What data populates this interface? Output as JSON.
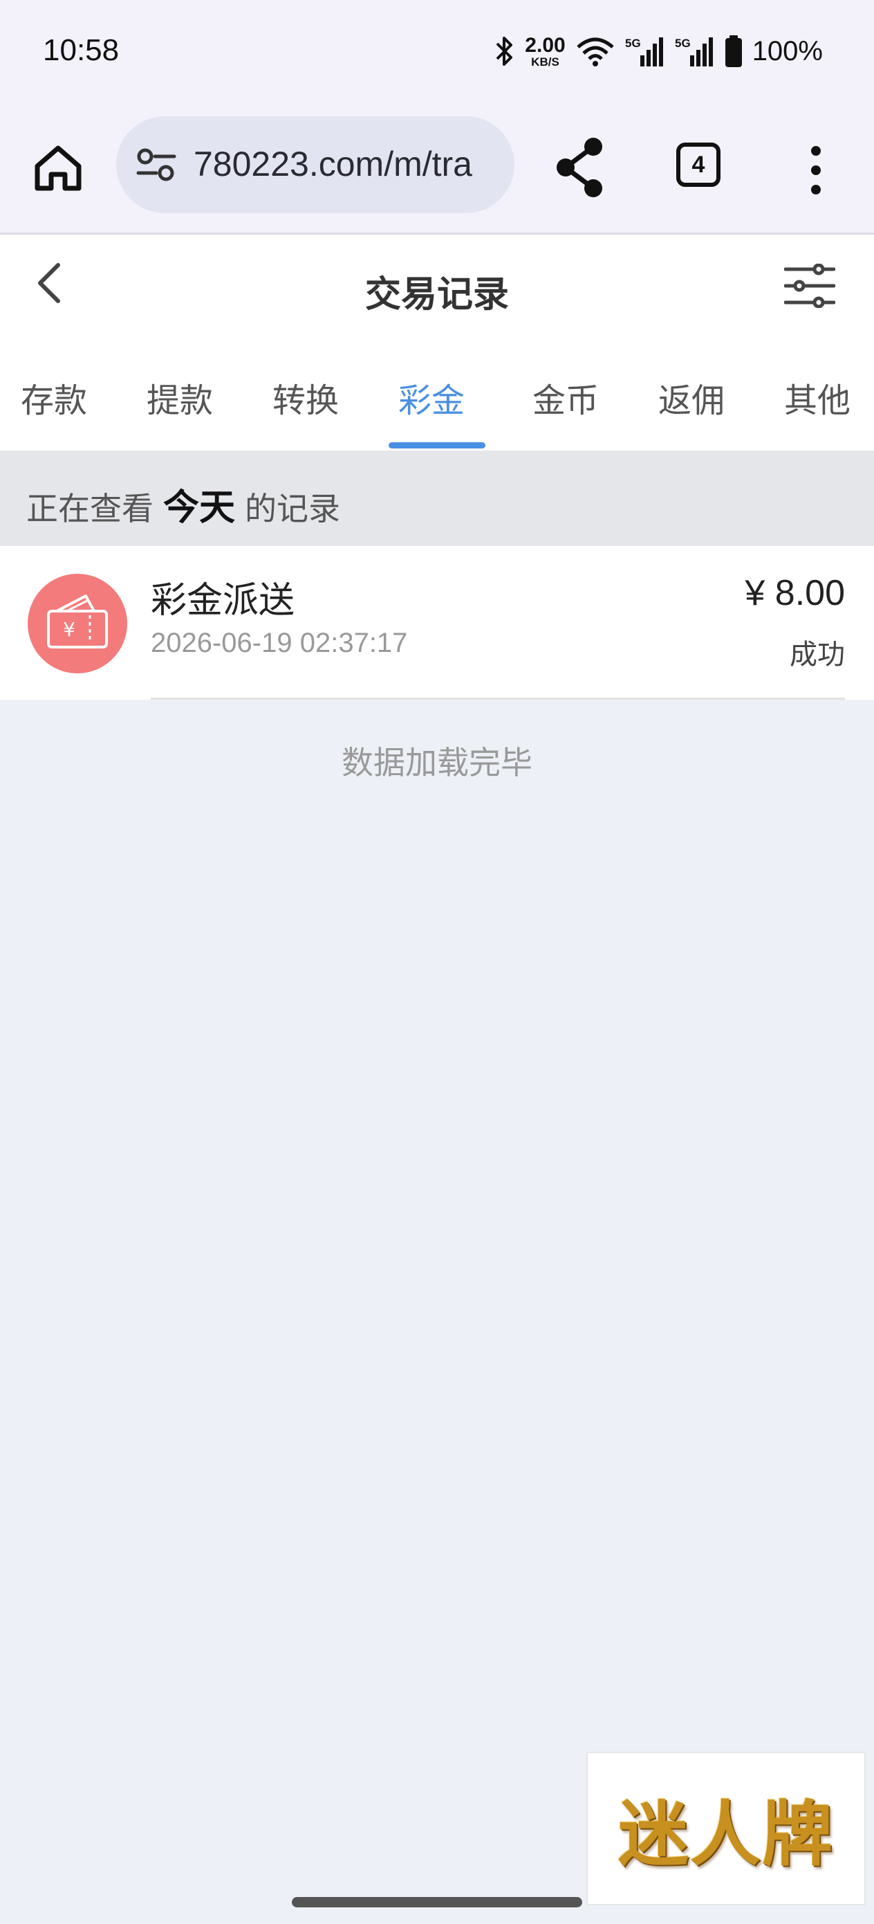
{
  "status_bar": {
    "time": "10:58",
    "net_speed_value": "2.00",
    "net_speed_unit": "KB/S",
    "signal_1_label": "5G",
    "signal_2_label": "5G",
    "battery": "100%"
  },
  "browser": {
    "url": "780223.com/m/tra",
    "tab_count": "4"
  },
  "header": {
    "title": "交易记录"
  },
  "tabs": [
    {
      "label": "存款",
      "active": false
    },
    {
      "label": "提款",
      "active": false
    },
    {
      "label": "转换",
      "active": false
    },
    {
      "label": "彩金",
      "active": true
    },
    {
      "label": "金币",
      "active": false
    },
    {
      "label": "返佣",
      "active": false
    },
    {
      "label": "其他",
      "active": false
    }
  ],
  "viewing": {
    "prefix": "正在查看",
    "period": "今天",
    "suffix": "的记录"
  },
  "records": [
    {
      "title": "彩金派送",
      "time": "2026-06-19 02:37:17",
      "amount": "¥ 8.00",
      "status": "成功",
      "icon": "red-envelope-icon"
    }
  ],
  "load_done": "数据加载完毕",
  "watermark": "迷人牌",
  "colors": {
    "accent": "#4a90e2",
    "record_icon_bg": "#f47b7b",
    "page_bg": "#edf1f7"
  }
}
